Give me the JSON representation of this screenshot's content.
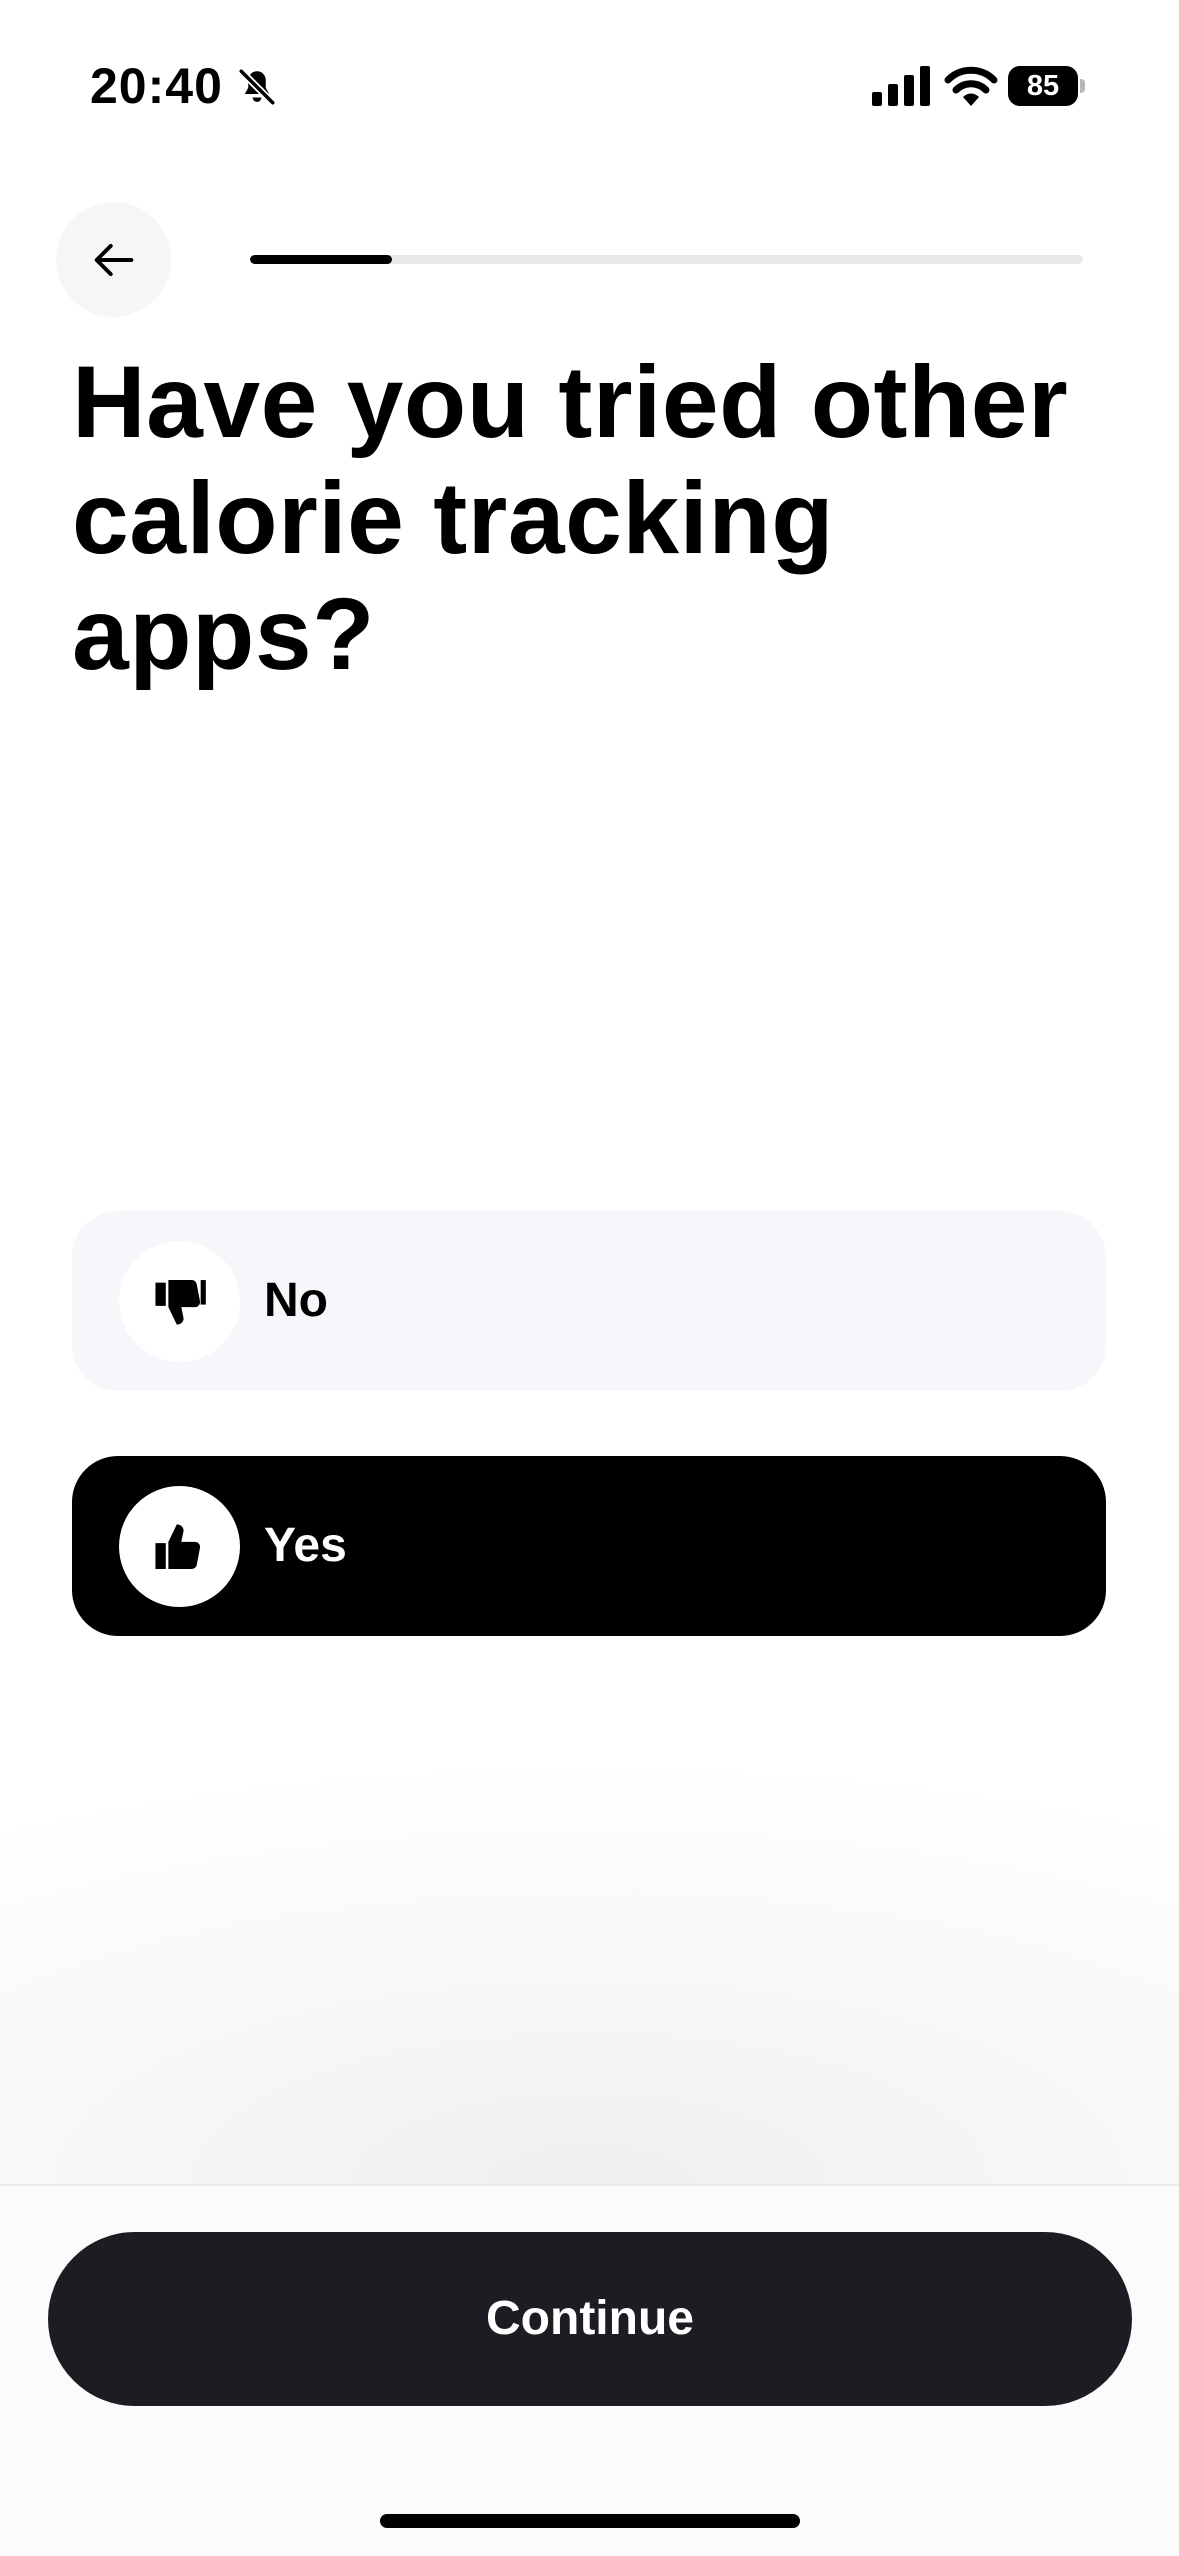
{
  "status_bar": {
    "time": "20:40",
    "battery_level": "85",
    "icons": [
      "bell-off-icon",
      "cellular-signal-icon",
      "wifi-icon",
      "battery-icon"
    ]
  },
  "header": {
    "back_icon": "arrow-left-icon",
    "progress_fraction": 0.17
  },
  "question": {
    "title": "Have you tried other calorie tracking apps?"
  },
  "options": [
    {
      "label": "No",
      "icon": "thumbs-down-icon",
      "selected": false
    },
    {
      "label": "Yes",
      "icon": "thumbs-up-icon",
      "selected": true
    }
  ],
  "footer": {
    "continue_label": "Continue"
  },
  "colors": {
    "primary_dark": "#1d1c23",
    "selected_option_bg": "#000000",
    "unselected_option_bg": "#f6f6fb",
    "progress_track": "#e9e9ec"
  }
}
